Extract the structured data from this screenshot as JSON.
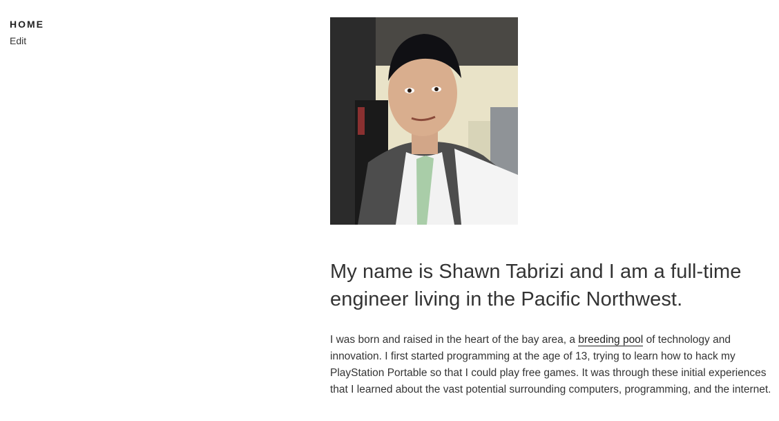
{
  "sidebar": {
    "title": "HOME",
    "edit_label": "Edit"
  },
  "profile": {
    "photo_subject": "portrait-photo",
    "headline": "My name is Shawn Tabrizi and I am a full-time engineer living in the Pacific Northwest.",
    "paragraph": {
      "before_link": "I was born and raised in the heart of the bay area, a ",
      "link_text": "breeding pool",
      "after_link": " of technology and innovation. I first started programming at the age of 13, trying to learn how to hack my PlayStation Portable so that I could play free games. It was through these initial experiences that I learned about the vast potential surrounding computers, programming, and the internet."
    }
  },
  "colors": {
    "text": "#333333",
    "heading": "#222222",
    "background": "#ffffff"
  }
}
